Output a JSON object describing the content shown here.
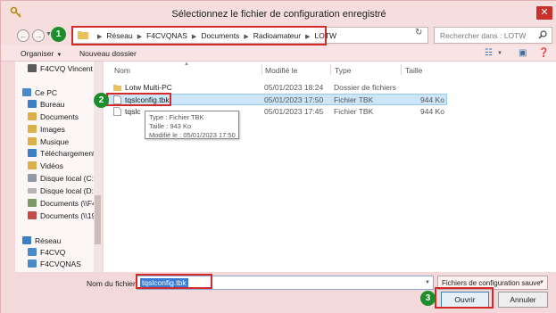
{
  "window": {
    "title": "Sélectionnez le fichier de configuration enregistré",
    "close_glyph": "✕"
  },
  "nav": {
    "back_glyph": "←",
    "forward_glyph": "→",
    "path": [
      "Réseau",
      "F4CVQNAS",
      "Documents",
      "Radioamateur",
      "LOTW"
    ],
    "search_placeholder": "Rechercher dans : LOTW"
  },
  "toolbar": {
    "organize": "Organiser",
    "new_folder": "Nouveau dossier"
  },
  "sidebar": {
    "items": [
      {
        "label": "F4CVQ Vincent",
        "icon": "user-icon"
      },
      {
        "label": "Ce PC",
        "icon": "computer-icon"
      },
      {
        "label": "Bureau",
        "icon": "desktop-icon"
      },
      {
        "label": "Documents",
        "icon": "documents-icon"
      },
      {
        "label": "Images",
        "icon": "pictures-icon"
      },
      {
        "label": "Musique",
        "icon": "music-icon"
      },
      {
        "label": "Téléchargements",
        "icon": "downloads-icon"
      },
      {
        "label": "Vidéos",
        "icon": "videos-icon"
      },
      {
        "label": "Disque local (C:)",
        "icon": "drive-icon"
      },
      {
        "label": "Disque local (D:)",
        "icon": "drive-icon"
      },
      {
        "label": "Documents (\\\\F4",
        "icon": "network-drive-icon"
      },
      {
        "label": "Documents (\\\\19",
        "icon": "network-drive-icon"
      },
      {
        "label": "Réseau",
        "icon": "network-icon"
      },
      {
        "label": "F4CVQ",
        "icon": "computer-icon"
      },
      {
        "label": "F4CVQNAS",
        "icon": "computer-icon"
      }
    ]
  },
  "filelist": {
    "headers": {
      "name": "Nom",
      "modified": "Modifié le",
      "type": "Type",
      "size": "Taille"
    },
    "rows": [
      {
        "name": "Lotw Multi-PC",
        "modified": "05/01/2023 18:24",
        "type": "Dossier de fichiers",
        "size": "",
        "kind": "folder"
      },
      {
        "name": "tqslconfig.tbk",
        "modified": "05/01/2023 17:50",
        "type": "Fichier TBK",
        "size": "944 Ko",
        "kind": "file",
        "selected": true
      },
      {
        "name": "tqslc",
        "modified": "05/01/2023 17:45",
        "type": "Fichier TBK",
        "size": "944 Ko",
        "kind": "file"
      }
    ],
    "tooltip": {
      "line1": "Type : Fichier TBK",
      "line2": "Taille : 943 Ko",
      "line3": "Modifié le : 05/01/2023 17:50"
    }
  },
  "bottom": {
    "filename_label": "Nom du fichier :",
    "filename_value": "tqslconfig.tbk",
    "filetype": "Fichiers de configuration sauve",
    "open": "Ouvrir",
    "cancel": "Annuler"
  },
  "badges": [
    "1",
    "2",
    "3"
  ],
  "colors": {
    "highlight": "#d42a2a",
    "badge": "#1e8e2c",
    "selection": "#cde6f7",
    "close": "#c9302c"
  }
}
